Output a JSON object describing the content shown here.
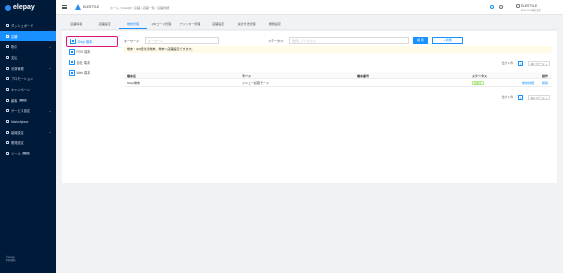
{
  "sidebar": {
    "logo_text": "elepay",
    "items": [
      {
        "label": "ダッシュボード",
        "icon": "dashboard-icon",
        "active": false,
        "chevron": false,
        "tag": ""
      },
      {
        "label": "店舗",
        "icon": "store-icon",
        "active": true,
        "chevron": false,
        "tag": ""
      },
      {
        "label": "取引",
        "icon": "transaction-icon",
        "active": false,
        "chevron": true,
        "tag": ""
      },
      {
        "label": "支払",
        "icon": "payment-icon",
        "active": false,
        "chevron": false,
        "tag": ""
      },
      {
        "label": "決済管理",
        "icon": "settlement-icon",
        "active": false,
        "chevron": true,
        "tag": ""
      },
      {
        "label": "プロモーション",
        "icon": "promotion-icon",
        "active": false,
        "chevron": false,
        "tag": ""
      },
      {
        "label": "キャンペーン",
        "icon": "campaign-icon",
        "active": false,
        "chevron": false,
        "tag": ""
      },
      {
        "label": "顧客",
        "icon": "customer-icon",
        "active": false,
        "chevron": false,
        "tag": "BETA"
      },
      {
        "label": "サービス設定",
        "icon": "service-settings-icon",
        "active": false,
        "chevron": true,
        "tag": ""
      },
      {
        "label": "Marketplace",
        "icon": "marketplace-icon",
        "active": false,
        "chevron": false,
        "tag": ""
      },
      {
        "label": "組織設定",
        "icon": "organization-settings-icon",
        "active": false,
        "chevron": true,
        "tag": ""
      },
      {
        "label": "開発設定",
        "icon": "developer-settings-icon",
        "active": false,
        "chevron": false,
        "tag": ""
      },
      {
        "label": "ツール",
        "icon": "tools-icon",
        "active": false,
        "chevron": false,
        "tag": "BETA"
      }
    ],
    "footer_line1": "©elepay",
    "footer_line2": "利用規約"
  },
  "topbar": {
    "brand_name": "ELESTYLE",
    "breadcrumb": "ホーム  /  OneQR  /  店舗  /  店舗一覧  /  店舗詳細",
    "user_name": "ELESTYLE",
    "user_sub": "ELESTYLE株式会社"
  },
  "tabs": [
    {
      "label": "店舗情報",
      "active": false
    },
    {
      "label": "店舗設定",
      "active": false
    },
    {
      "label": "端末管理",
      "active": true
    },
    {
      "label": "QRコード管理",
      "active": false
    },
    {
      "label": "プリンター管理",
      "active": false
    },
    {
      "label": "店舗設定",
      "active": false
    },
    {
      "label": "決済方法管理",
      "active": false
    },
    {
      "label": "機能設定",
      "active": false
    }
  ],
  "left_menu": [
    {
      "label": "Shop 端末",
      "active": true
    },
    {
      "label": "POS 端末",
      "active": false
    },
    {
      "label": "自社 端末",
      "active": false
    },
    {
      "label": "Web 端末",
      "active": false
    }
  ],
  "search": {
    "keyword_label": "キーワード:",
    "keyword_placeholder": "キーワード",
    "status_label": "ステータス:",
    "status_placeholder": "選択してください",
    "search_button": "検 索",
    "add_button": "+ 新規"
  },
  "notice": "端末・QR紐付済端末、端末へ店舗設定できます。",
  "pagination": {
    "total": "合計 1 件",
    "prev": "‹",
    "page": "1",
    "next": "›",
    "page_size": "10 / ページ ⌄"
  },
  "table": {
    "headers": [
      "端末名",
      "モード",
      "端末番号",
      "ステータス",
      "操作"
    ],
    "rows": [
      {
        "name": "Shop端末",
        "mode": "メニュー読取モード",
        "number": "",
        "status": "利用中",
        "action_edit": "端末詳細",
        "action_delete": "削除"
      }
    ]
  },
  "colors": {
    "accent": "#1890ff",
    "sidebar_bg": "#001a3a",
    "highlight_border": "#e0157a"
  }
}
